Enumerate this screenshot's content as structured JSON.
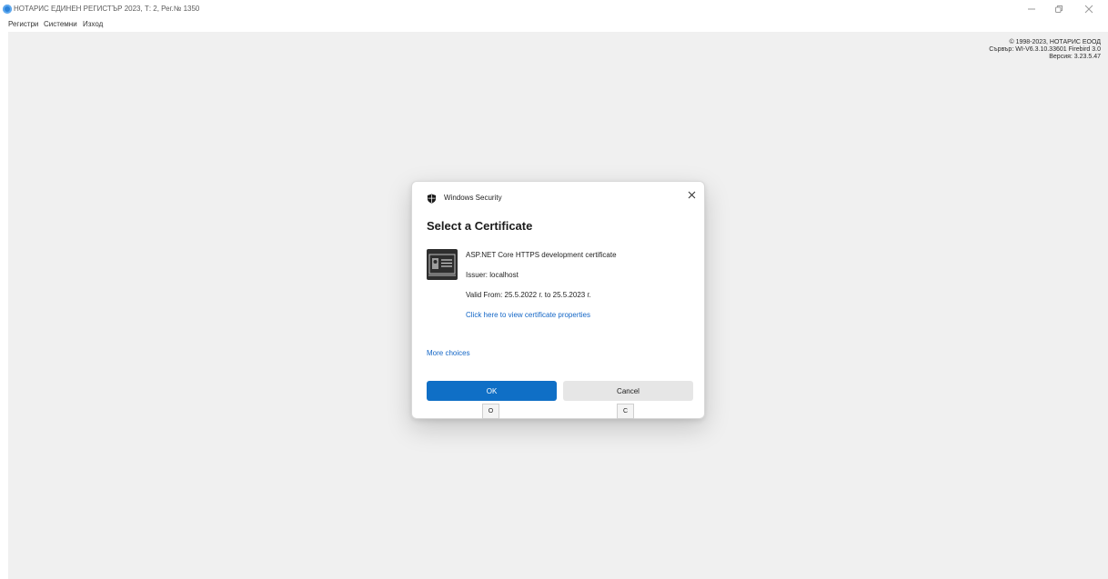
{
  "window": {
    "title": "НОТАРИС ЕДИНЕН РЕГИСТЪР 2023,  Т: 2, Рег.№ 1350"
  },
  "menu": {
    "items": [
      "Регистри",
      "Системни",
      "Изход"
    ]
  },
  "info": {
    "copyright": "© 1998-2023, НОТАРИС ЕООД",
    "server": "Сървър: WI-V6.3.10.33601 Firebird 3.0",
    "version": "Версия: 3.23.5.47"
  },
  "dialog": {
    "header": "Windows Security",
    "heading": "Select a Certificate",
    "certificate": {
      "name": "ASP.NET Core HTTPS development certificate",
      "issuer": "Issuer: localhost",
      "valid": "Valid From: 25.5.2022 г. to 25.5.2023 г.",
      "properties_link": "Click here to view certificate properties"
    },
    "more_choices": "More choices",
    "ok_label": "OK",
    "cancel_label": "Cancel",
    "ok_keytip": "O",
    "cancel_keytip": "C"
  },
  "icons": {
    "app": "app-logo-icon",
    "minimize": "minimize-icon",
    "restore": "restore-icon",
    "close": "close-icon",
    "shield": "shield-icon",
    "certificate": "certificate-icon"
  },
  "colors": {
    "accent": "#0f6fc6",
    "link": "#1366c6",
    "client_bg": "#f0f0f0"
  }
}
